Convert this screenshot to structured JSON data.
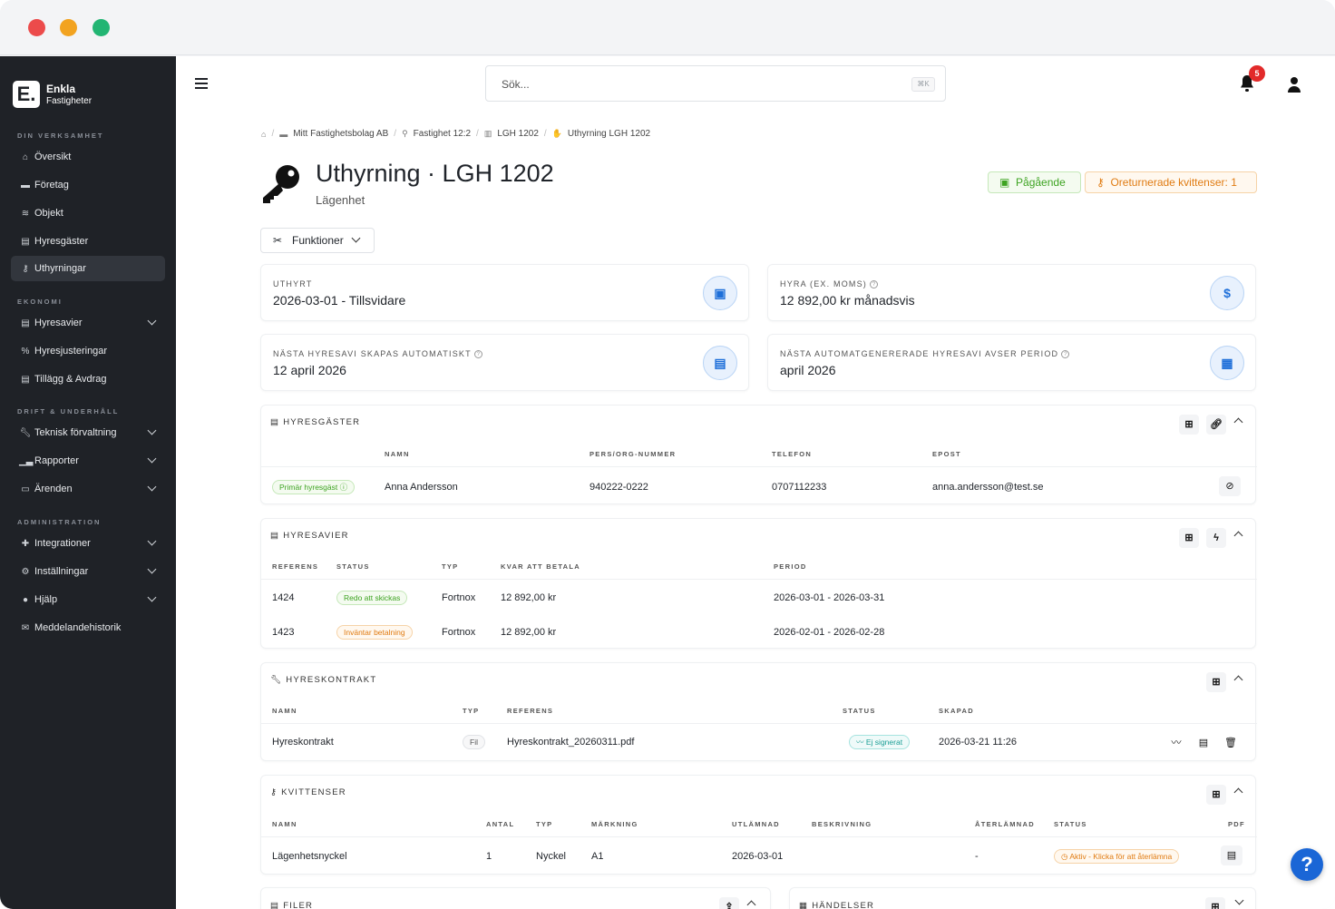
{
  "window": {
    "controls": [
      "close",
      "minimize",
      "maximize"
    ],
    "colors": {
      "close": "#ec4b4b",
      "minimize": "#f2a320",
      "maximize": "#22b573"
    }
  },
  "brand": {
    "logo_letter": "E.",
    "name": "Enkla",
    "sub": "Fastigheter"
  },
  "sidebar": {
    "sections": [
      {
        "title": "DIN VERKSAMHET",
        "items": [
          {
            "label": "Översikt",
            "icon": "home-icon"
          },
          {
            "label": "Företag",
            "icon": "briefcase-icon"
          },
          {
            "label": "Objekt",
            "icon": "layers-icon"
          },
          {
            "label": "Hyresgäster",
            "icon": "id-card-icon"
          },
          {
            "label": "Uthyrningar",
            "icon": "key-icon",
            "active": true
          }
        ]
      },
      {
        "title": "EKONOMI",
        "items": [
          {
            "label": "Hyresavier",
            "icon": "document-icon",
            "expandable": true
          },
          {
            "label": "Hyresjusteringar",
            "icon": "percent-icon"
          },
          {
            "label": "Tillägg & Avdrag",
            "icon": "document-icon"
          }
        ]
      },
      {
        "title": "DRIFT & UNDERHÅLL",
        "items": [
          {
            "label": "Teknisk förvaltning",
            "icon": "wrench-icon",
            "expandable": true
          },
          {
            "label": "Rapporter",
            "icon": "chart-icon",
            "expandable": true
          },
          {
            "label": "Ärenden",
            "icon": "inbox-icon",
            "expandable": true
          }
        ]
      },
      {
        "title": "ADMINISTRATION",
        "items": [
          {
            "label": "Integrationer",
            "icon": "puzzle-icon",
            "expandable": true
          },
          {
            "label": "Inställningar",
            "icon": "gears-icon",
            "expandable": true
          },
          {
            "label": "Hjälp",
            "icon": "info-icon",
            "expandable": true
          },
          {
            "label": "Meddelandehistorik",
            "icon": "envelope-icon"
          }
        ]
      }
    ]
  },
  "topbar": {
    "search_placeholder": "Sök...",
    "search_shortcut": "⌘K",
    "notifications": "5"
  },
  "breadcrumb": [
    "Mitt Fastighetsbolag AB",
    "Fastighet 12:2",
    "LGH 1202",
    "Uthyrning LGH 1202"
  ],
  "page": {
    "title": "Uthyrning · LGH 1202",
    "subtitle": "Lägenhet",
    "status_tag": "Pågående",
    "warning_tag": "Oreturnerade kvittenser: 1",
    "functions_button": "Funktioner"
  },
  "stats": [
    {
      "label": "UTHYRT",
      "value": "2026-03-01 - Tillsvidare",
      "icon": "calendar-check-icon",
      "help": false
    },
    {
      "label": "HYRA (EX. MOMS)",
      "value": "12 892,00 kr månadsvis",
      "icon": "dollar-icon",
      "help": true
    },
    {
      "label": "NÄSTA HYRESAVI SKAPAS AUTOMATISKT",
      "value": "12 april 2026",
      "icon": "document-icon",
      "help": true
    },
    {
      "label": "NÄSTA AUTOMATGENERERADE HYRESAVI AVSER PERIOD",
      "value": "april 2026",
      "icon": "calendar-icon",
      "help": true
    }
  ],
  "tenants": {
    "title": "HYRESGÄSTER",
    "columns": [
      "NAMN",
      "PERS/ORG-NUMMER",
      "TELEFON",
      "EPOST"
    ],
    "rows": [
      {
        "badge": "Primär hyresgäst",
        "name": "Anna Andersson",
        "id": "940222-0222",
        "phone": "0707112233",
        "email": "anna.andersson@test.se"
      }
    ]
  },
  "invoices": {
    "title": "HYRESAVIER",
    "columns": [
      "REFERENS",
      "STATUS",
      "TYP",
      "KVAR ATT BETALA",
      "PERIOD"
    ],
    "rows": [
      {
        "ref": "1424",
        "status": "Redo att skickas",
        "status_color": "green",
        "type": "Fortnox",
        "due": "12 892,00 kr",
        "period": "2026-03-01 - 2026-03-31"
      },
      {
        "ref": "1423",
        "status": "Inväntar betalning",
        "status_color": "orange",
        "type": "Fortnox",
        "due": "12 892,00 kr",
        "period": "2026-02-01 - 2026-02-28"
      }
    ]
  },
  "contracts": {
    "title": "HYRESKONTRAKT",
    "columns": [
      "NAMN",
      "TYP",
      "REFERENS",
      "STATUS",
      "SKAPAD"
    ],
    "rows": [
      {
        "name": "Hyreskontrakt",
        "type": "Fil",
        "ref": "Hyreskontrakt_20260311.pdf",
        "status": "Ej signerat",
        "created": "2026-03-21 11:26"
      }
    ]
  },
  "receipts": {
    "title": "KVITTENSER",
    "columns": [
      "NAMN",
      "ANTAL",
      "TYP",
      "MÄRKNING",
      "UTLÄMNAD",
      "BESKRIVNING",
      "ÅTERLÄMNAD",
      "STATUS",
      "PDF"
    ],
    "rows": [
      {
        "name": "Lägenhetsnyckel",
        "count": "1",
        "type": "Nyckel",
        "mark": "A1",
        "handed": "2026-03-01",
        "desc": "",
        "returned": "-",
        "status": "Aktiv - Klicka för att återlämna"
      }
    ]
  },
  "files": {
    "title": "FILER"
  },
  "events": {
    "title": "HÄNDELSER"
  },
  "help_button": "?"
}
